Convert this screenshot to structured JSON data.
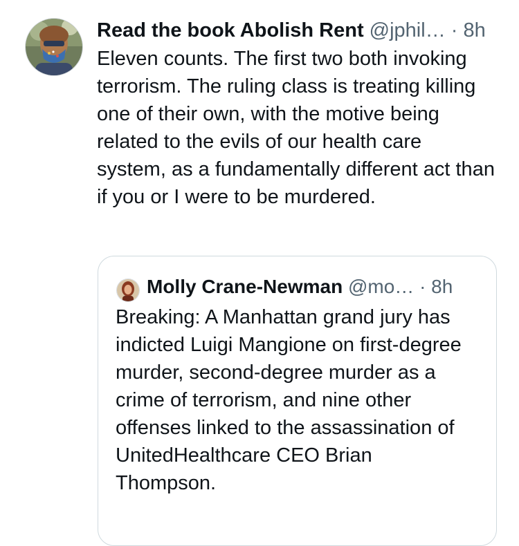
{
  "post": {
    "author_name": "Read the book Abolish Rent",
    "handle": "@jphil…",
    "separator": "·",
    "time": "8h",
    "text": "Eleven counts. The first two both invoking terrorism. The ruling class is treating killing one of their own, with the motive being related to the evils of our health care system, as a fundamentally different act than if you or I were to be murdered."
  },
  "quoted_post": {
    "author_name": "Molly Crane-Newman",
    "handle": "@mo…",
    "separator": "·",
    "time": "8h",
    "text": "Breaking: A Manhattan grand jury has indicted Luigi Mangione on first-degree murder, second-degree murder as a crime of terrorism, and nine other offenses linked to the assassination of UnitedHealthcare CEO Brian Thompson."
  }
}
